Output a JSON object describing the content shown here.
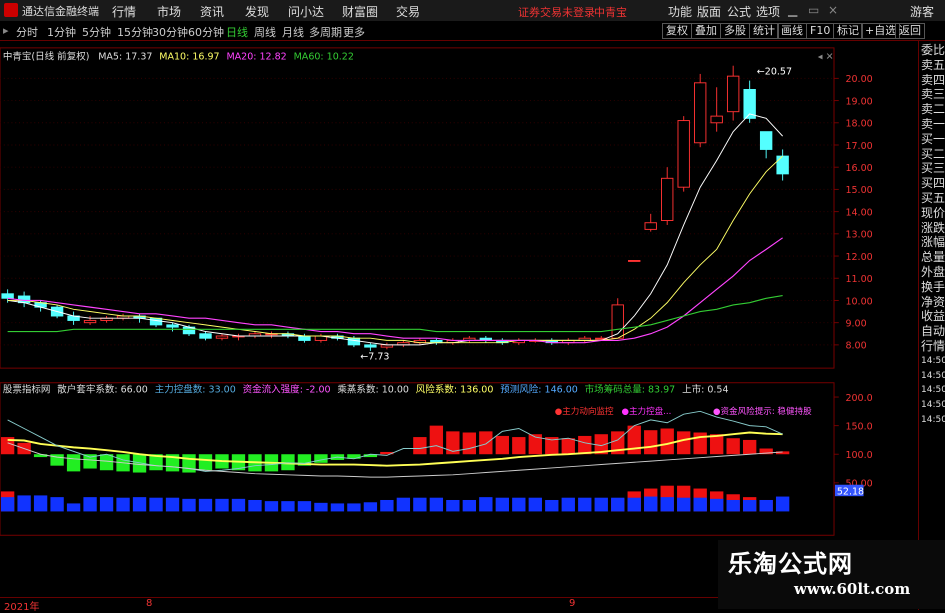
{
  "titlebar": {
    "app_name": "通达信金融终端",
    "menus": [
      "行情",
      "市场",
      "资讯",
      "发现",
      "问小达",
      "财富圈",
      "交易"
    ],
    "warning": "证券交易未登录",
    "stock": "中青宝",
    "right_menus": [
      "功能",
      "版面",
      "公式",
      "选项"
    ],
    "guest": "游客"
  },
  "periods": [
    "分时",
    "1分钟",
    "5分钟",
    "15分钟",
    "30分钟",
    "60分钟",
    "日线",
    "周线",
    "月线",
    "多周期",
    "更多"
  ],
  "active_period": "日线",
  "right_buttons": [
    "复权",
    "叠加",
    "多股",
    "统计",
    "画线",
    "F10",
    "标记",
    "+自选",
    "返回"
  ],
  "main": {
    "title": "中青宝(日线 前复权)",
    "ma5": "MA5: 17.37",
    "ma10": "MA10: 16.97",
    "ma20": "MA20: 12.82",
    "ma60": "MA60: 10.22",
    "high_label": "20.57",
    "low_label": "7.73",
    "price_ticks": [
      "20.00",
      "19.00",
      "18.00",
      "17.00",
      "16.00",
      "15.00",
      "14.00",
      "13.00",
      "12.00",
      "11.00",
      "10.00",
      "9.00",
      "8.00"
    ],
    "colors": {
      "up": "#ff3232",
      "down": "#54ffff",
      "ma5": "#ffffff",
      "ma10": "#ffff66",
      "ma20": "#ff44ff",
      "ma60": "#33cc33",
      "frame": "#7a0000"
    }
  },
  "indicator": {
    "name": "股票指标网",
    "f1": "散户套牢系数: 66.00",
    "f2": "主力控盘数: 33.00",
    "f3": "资金流入强度: -2.00",
    "f4": "乘蒸系数: 10.00",
    "f5": "风险系数: 136.00",
    "f6": "预测风险: 146.00",
    "f7": "市场筹码总量: 83.97",
    "f8": "上市: 0.54",
    "legend1": "主力动向监控",
    "legend2": "主力控盘...",
    "legend3": "资金风险提示: 稳健持股",
    "ticks": [
      "200.0",
      "150.0",
      "100.0",
      "50.00"
    ],
    "current_value": "52.18"
  },
  "sidebar": [
    "委比",
    "卖五",
    "卖四",
    "卖三",
    "卖二",
    "卖一",
    "买一",
    "买二",
    "买三",
    "买四",
    "买五",
    "现价",
    "涨跌",
    "涨幅",
    "总量",
    "外盘",
    "换手",
    "净资",
    "收益",
    "自动",
    "行情",
    "14:50",
    "14:50",
    "14:50",
    "14:50",
    "14:50"
  ],
  "date_axis": {
    "year": "2021年",
    "m1": "8",
    "m2": "9"
  },
  "watermark": {
    "line1": "乐淘公式网",
    "line2": "www.60lt.com"
  }
}
